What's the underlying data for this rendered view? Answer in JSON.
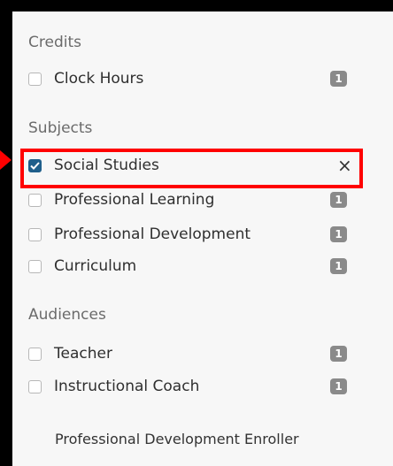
{
  "credits": {
    "title": "Credits",
    "items": [
      {
        "label": "Clock Hours",
        "count": "1",
        "checked": false
      }
    ]
  },
  "subjects": {
    "title": "Subjects",
    "selected": {
      "label": "Social Studies",
      "clear_symbol": "×",
      "checked": true
    },
    "items": [
      {
        "label": "Professional Learning",
        "count": "1",
        "checked": false
      },
      {
        "label": "Professional Development",
        "count": "1",
        "checked": false
      },
      {
        "label": "Curriculum",
        "count": "1",
        "checked": false
      }
    ]
  },
  "audiences": {
    "title": "Audiences",
    "items": [
      {
        "label": "Teacher",
        "count": "1",
        "checked": false
      },
      {
        "label": "Instructional Coach",
        "count": "1",
        "checked": false
      }
    ]
  },
  "footer": {
    "text": "Professional Development Enroller"
  },
  "colors": {
    "accent": "#1f5f8b",
    "highlight": "#ff0000",
    "badge": "#8a8a8a"
  }
}
